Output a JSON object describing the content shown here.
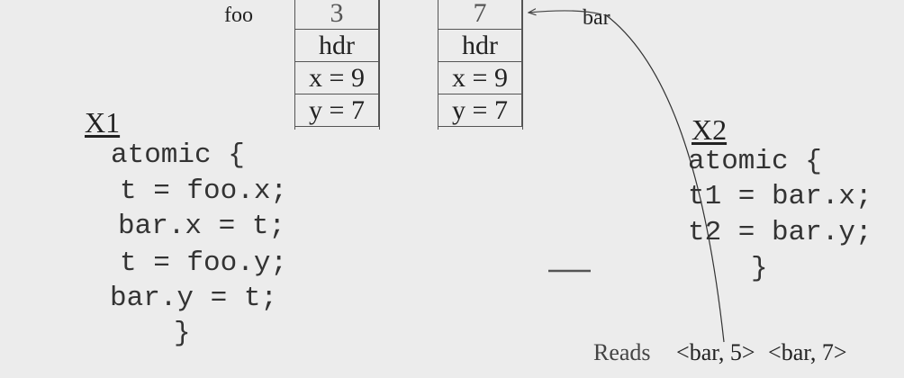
{
  "labels": {
    "foo": "foo",
    "bar": "bar"
  },
  "foo_object": {
    "header_value": "3",
    "hdr": "hdr",
    "x": "x = 9",
    "y": "y = 7"
  },
  "bar_object": {
    "header_value": "7",
    "hdr": "hdr",
    "x": "x = 9",
    "y": "y = 7"
  },
  "x1": {
    "title": "X1",
    "lines": [
      "atomic {",
      "t = foo.x;",
      "bar.x = t;",
      "t = foo.y;",
      "bar.y = t;",
      "}"
    ]
  },
  "x2": {
    "title": "X2",
    "lines": [
      "atomic {",
      "t1 = bar.x;",
      "t2 = bar.y;",
      "}"
    ]
  },
  "reads": {
    "label": "Reads",
    "entries": [
      "<bar, 5>",
      "<bar, 7>"
    ]
  }
}
